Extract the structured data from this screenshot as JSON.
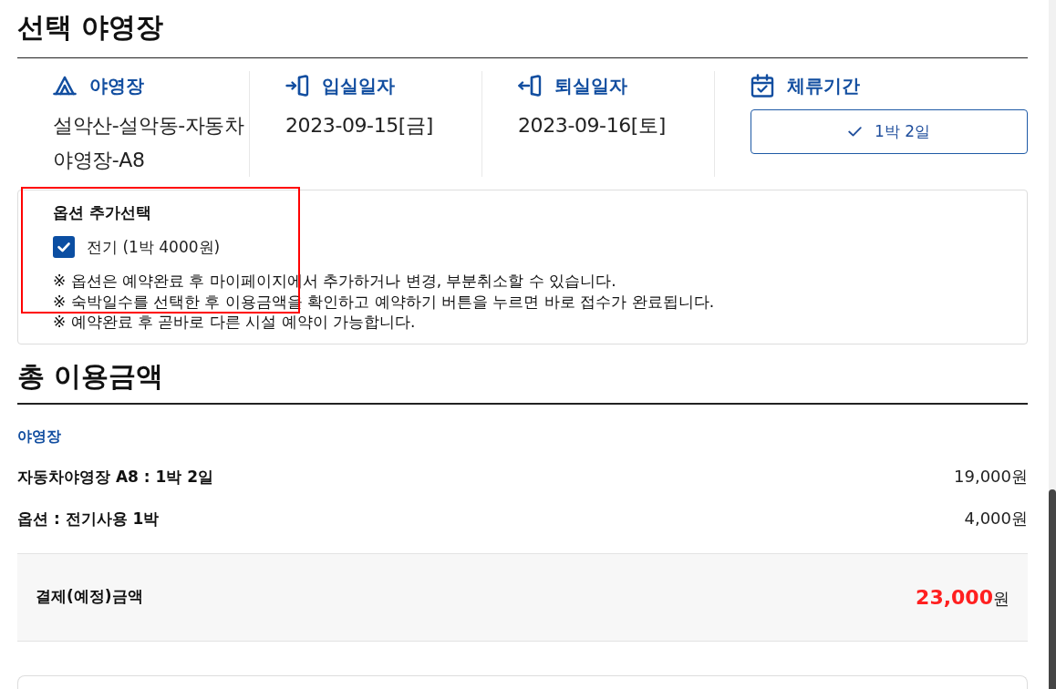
{
  "section_title": "선택 야영장",
  "columns": [
    {
      "kind": "campsite",
      "label": "야영장",
      "value": "설악산-설악동-자동차야영장-A8"
    },
    {
      "kind": "checkin",
      "label": "입실일자",
      "value": "2023-09-15[금]"
    },
    {
      "kind": "checkout",
      "label": "퇴실일자",
      "value": "2023-09-16[토]"
    },
    {
      "kind": "duration",
      "label": "체류기간",
      "choice": {
        "label": "1박 2일",
        "selected": true
      }
    }
  ],
  "options": {
    "highlighted": true,
    "title": "옵션 추가선택",
    "items": [
      {
        "label": "전기 (1박 4000원)",
        "checked": true
      }
    ],
    "notes": [
      "※ 옵션은 예약완료 후 마이페이지에서 추가하거나 변경, 부분취소할 수 있습니다.",
      "※ 숙박일수를 선택한 후 이용금액을 확인하고 예약하기 버튼을 누르면 바로 접수가 완료됩니다.",
      "※ 예약완료 후 곧바로 다른 시설 예약이 가능합니다."
    ]
  },
  "total": {
    "title": "총 이용금액",
    "heading": "야영장",
    "rows": [
      {
        "label": "자동차야영장 A8 : 1박 2일",
        "amount": "19,000원"
      },
      {
        "label": "옵션 : 전기사용 1박",
        "amount": "4,000원"
      }
    ],
    "payment": {
      "label": "결제(예정)금액",
      "amount": "23,000",
      "unit": "원"
    }
  }
}
